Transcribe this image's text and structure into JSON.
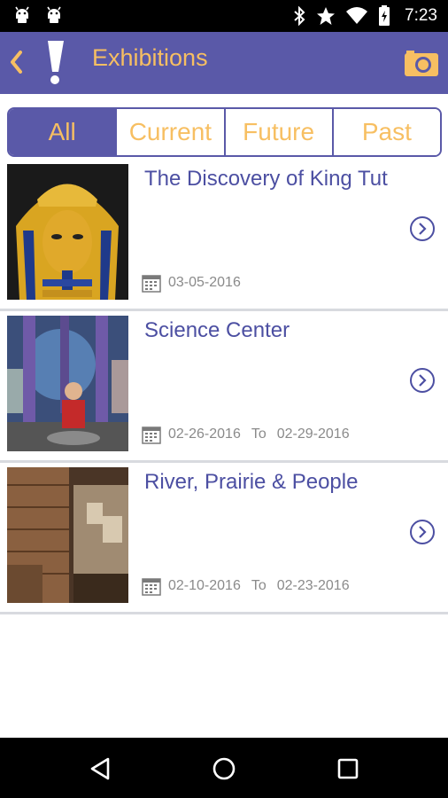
{
  "status_bar": {
    "time": "7:23"
  },
  "app_bar": {
    "title": "Exhibitions"
  },
  "tabs": [
    {
      "label": "All",
      "active": true
    },
    {
      "label": "Current",
      "active": false
    },
    {
      "label": "Future",
      "active": false
    },
    {
      "label": "Past",
      "active": false
    }
  ],
  "exhibitions": [
    {
      "title": "The Discovery of King Tut",
      "start": "03-05-2016",
      "to": "",
      "end": ""
    },
    {
      "title": "Science Center",
      "start": "02-26-2016",
      "to": "To",
      "end": "02-29-2016"
    },
    {
      "title": "River, Prairie & People",
      "start": "02-10-2016",
      "to": "To",
      "end": "02-23-2016"
    }
  ],
  "colors": {
    "primary": "#5a59a8",
    "accent": "#f7bf62",
    "title_text": "#4c4fa2",
    "date_text": "#8a8a8a"
  },
  "icons": [
    "android-icon",
    "bluetooth-icon",
    "star-icon",
    "wifi-icon",
    "battery-icon",
    "back-chevron-icon",
    "exclamation-logo-icon",
    "camera-icon",
    "calendar-icon",
    "chevron-right-circle-icon",
    "nav-back-icon",
    "nav-home-icon",
    "nav-recents-icon"
  ]
}
